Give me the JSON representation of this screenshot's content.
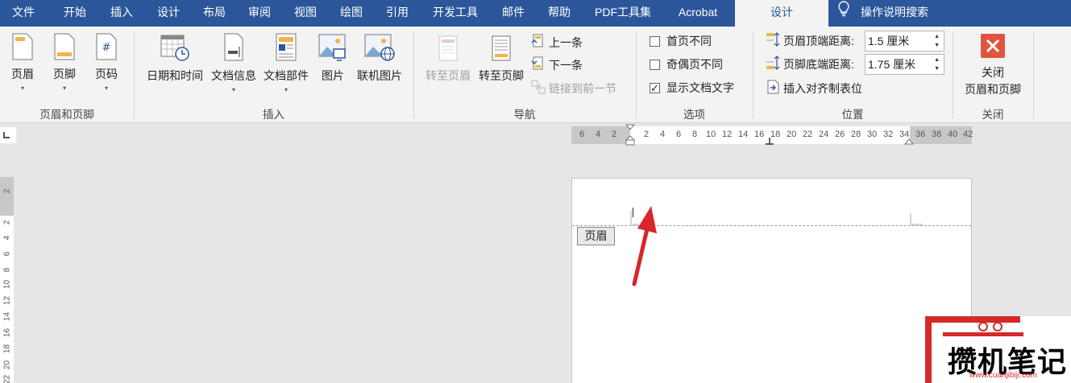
{
  "menu": {
    "tabs": [
      "文件",
      "开始",
      "插入",
      "设计",
      "布局",
      "审阅",
      "视图",
      "绘图",
      "引用",
      "开发工具",
      "邮件",
      "帮助",
      "PDF工具集",
      "Acrobat",
      "设计"
    ],
    "active_index": 14,
    "search_label": "操作说明搜索"
  },
  "ribbon": {
    "header_footer": {
      "group_label": "页眉和页脚",
      "header": "页眉",
      "footer": "页脚",
      "page_number": "页码"
    },
    "insert": {
      "group_label": "插入",
      "date_time": "日期和时间",
      "doc_info": "文档信息",
      "doc_parts": "文档部件",
      "picture": "图片",
      "online_picture": "联机图片"
    },
    "navigation": {
      "group_label": "导航",
      "goto_header": "转至页眉",
      "goto_footer": "转至页脚",
      "previous": "上一条",
      "next": "下一条",
      "link_previous": "链接到前一节"
    },
    "options": {
      "group_label": "选项",
      "different_first_page": "首页不同",
      "different_odd_even": "奇偶页不同",
      "show_document_text": "显示文档文字",
      "show_document_text_checked": true
    },
    "position": {
      "group_label": "位置",
      "header_from_top_label": "页眉顶端距离:",
      "header_from_top_value": "1.5 厘米",
      "footer_from_bottom_label": "页脚底端距离:",
      "footer_from_bottom_value": "1.75 厘米",
      "insert_alignment_tab": "插入对齐制表位"
    },
    "close": {
      "group_label": "关闭",
      "close_line1": "关闭",
      "close_line2": "页眉和页脚"
    }
  },
  "ruler": {
    "horizontal_ticks": [
      "6",
      "4",
      "2",
      "2",
      "4",
      "6",
      "8",
      "10",
      "12",
      "14",
      "16",
      "18",
      "20",
      "22",
      "24",
      "26",
      "28",
      "30",
      "32",
      "34",
      "36",
      "38",
      "40",
      "42"
    ],
    "vertical_ticks": [
      "2",
      "2",
      "4",
      "6",
      "8",
      "10",
      "12",
      "14",
      "16",
      "18",
      "20",
      "22"
    ]
  },
  "document": {
    "header_tag": "页眉"
  },
  "watermark": {
    "text": "攒机笔记",
    "url": "www.cuanjibiji.com"
  },
  "colors": {
    "accent": "#2b579a",
    "arrow": "#d9262c",
    "close_button": "#e0553f"
  }
}
